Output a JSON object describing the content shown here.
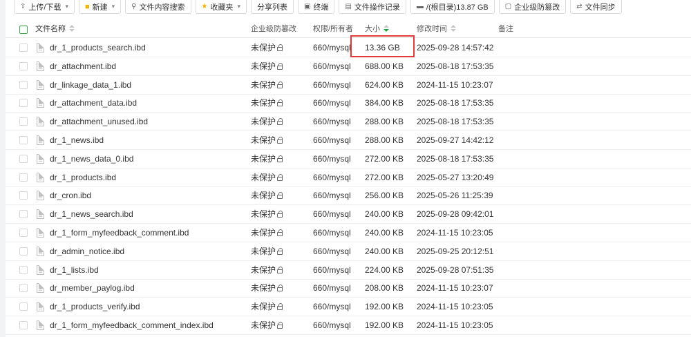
{
  "toolbar": {
    "upload": "上传/下载",
    "new": "新建",
    "content_search": "文件内容搜索",
    "favorites": "收藏夹",
    "share_list": "分享列表",
    "terminal": "终端",
    "op_log": "文件操作记录",
    "disk": "/(根目录)13.87 GB",
    "tamper_proof": "企业级防篡改",
    "file_sync": "文件同步"
  },
  "table": {
    "headers": {
      "name": "文件名称",
      "tamper": "企业级防篡改",
      "perm": "权限/所有者",
      "size": "大小",
      "mtime": "修改时间",
      "note": "备注"
    },
    "sort": {
      "column": "size",
      "direction": "desc"
    },
    "rows": [
      {
        "name": "dr_1_products_search.ibd",
        "tamper": "未保护",
        "perm": "660/mysql",
        "size": "13.36 GB",
        "mtime": "2025-09-28 14:57:42"
      },
      {
        "name": "dr_attachment.ibd",
        "tamper": "未保护",
        "perm": "660/mysql",
        "size": "688.00 KB",
        "mtime": "2025-08-18 17:53:35"
      },
      {
        "name": "dr_linkage_data_1.ibd",
        "tamper": "未保护",
        "perm": "660/mysql",
        "size": "624.00 KB",
        "mtime": "2024-11-15 10:23:07"
      },
      {
        "name": "dr_attachment_data.ibd",
        "tamper": "未保护",
        "perm": "660/mysql",
        "size": "384.00 KB",
        "mtime": "2025-08-18 17:53:35"
      },
      {
        "name": "dr_attachment_unused.ibd",
        "tamper": "未保护",
        "perm": "660/mysql",
        "size": "288.00 KB",
        "mtime": "2025-08-18 17:53:35"
      },
      {
        "name": "dr_1_news.ibd",
        "tamper": "未保护",
        "perm": "660/mysql",
        "size": "288.00 KB",
        "mtime": "2025-09-27 14:42:12"
      },
      {
        "name": "dr_1_news_data_0.ibd",
        "tamper": "未保护",
        "perm": "660/mysql",
        "size": "272.00 KB",
        "mtime": "2025-08-18 17:53:35"
      },
      {
        "name": "dr_1_products.ibd",
        "tamper": "未保护",
        "perm": "660/mysql",
        "size": "272.00 KB",
        "mtime": "2025-05-27 13:20:49"
      },
      {
        "name": "dr_cron.ibd",
        "tamper": "未保护",
        "perm": "660/mysql",
        "size": "256.00 KB",
        "mtime": "2025-05-26 11:25:39"
      },
      {
        "name": "dr_1_news_search.ibd",
        "tamper": "未保护",
        "perm": "660/mysql",
        "size": "240.00 KB",
        "mtime": "2025-09-28 09:42:01"
      },
      {
        "name": "dr_1_form_myfeedback_comment.ibd",
        "tamper": "未保护",
        "perm": "660/mysql",
        "size": "240.00 KB",
        "mtime": "2024-11-15 10:23:05"
      },
      {
        "name": "dr_admin_notice.ibd",
        "tamper": "未保护",
        "perm": "660/mysql",
        "size": "240.00 KB",
        "mtime": "2025-09-25 20:12:51"
      },
      {
        "name": "dr_1_lists.ibd",
        "tamper": "未保护",
        "perm": "660/mysql",
        "size": "224.00 KB",
        "mtime": "2025-09-28 07:51:35"
      },
      {
        "name": "dr_member_paylog.ibd",
        "tamper": "未保护",
        "perm": "660/mysql",
        "size": "208.00 KB",
        "mtime": "2024-11-15 10:23:07"
      },
      {
        "name": "dr_1_products_verify.ibd",
        "tamper": "未保护",
        "perm": "660/mysql",
        "size": "192.00 KB",
        "mtime": "2024-11-15 10:23:05"
      },
      {
        "name": "dr_1_form_myfeedback_comment_index.ibd",
        "tamper": "未保护",
        "perm": "660/mysql",
        "size": "192.00 KB",
        "mtime": "2024-11-15 10:23:05"
      }
    ]
  },
  "colors": {
    "accent": "#20a53a",
    "highlight": "#e03a3a"
  }
}
